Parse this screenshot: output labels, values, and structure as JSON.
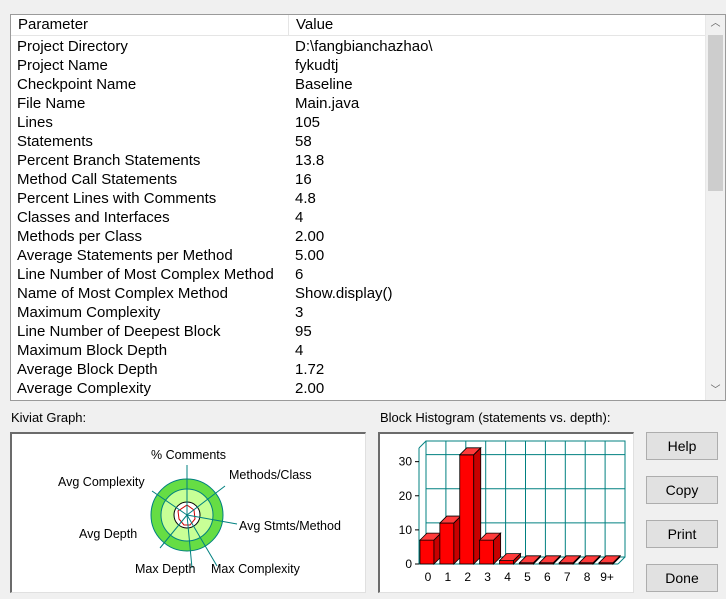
{
  "table": {
    "headers": {
      "parameter": "Parameter",
      "value": "Value"
    },
    "rows": [
      [
        "Project Directory",
        "D:\\fangbianchazhao\\"
      ],
      [
        "Project Name",
        "fykudtj"
      ],
      [
        "Checkpoint Name",
        "Baseline"
      ],
      [
        "File Name",
        "Main.java"
      ],
      [
        "Lines",
        "105"
      ],
      [
        "Statements",
        "58"
      ],
      [
        "Percent Branch Statements",
        "13.8"
      ],
      [
        "Method Call Statements",
        "16"
      ],
      [
        "Percent Lines with Comments",
        "4.8"
      ],
      [
        "Classes and Interfaces",
        "4"
      ],
      [
        "Methods per Class",
        "2.00"
      ],
      [
        "Average Statements per Method",
        "5.00"
      ],
      [
        "Line Number of Most Complex Method",
        "6"
      ],
      [
        "Name of Most Complex Method",
        "Show.display()"
      ],
      [
        "Maximum Complexity",
        "3"
      ],
      [
        "Line Number of Deepest Block",
        "95"
      ],
      [
        "Maximum Block Depth",
        "4"
      ],
      [
        "Average Block Depth",
        "1.72"
      ],
      [
        "Average Complexity",
        "2.00"
      ]
    ]
  },
  "scrollbar": {
    "up_glyph": "︿",
    "down_glyph": "﹀"
  },
  "kiviat": {
    "label": "Kiviat Graph:",
    "axes": [
      "% Comments",
      "Methods/Class",
      "Avg Stmts/Method",
      "Max Complexity",
      "Max Depth",
      "Avg Depth",
      "Avg Complexity"
    ]
  },
  "histogram": {
    "label": "Block Histogram (statements vs. depth):",
    "chart_data": {
      "type": "bar",
      "categories": [
        "0",
        "1",
        "2",
        "3",
        "4",
        "5",
        "6",
        "7",
        "8",
        "9+"
      ],
      "values": [
        7,
        12,
        32,
        7,
        1,
        0,
        0,
        0,
        0,
        0
      ],
      "ylim": [
        0,
        34
      ],
      "yticks": [
        0,
        10,
        20,
        30
      ],
      "grid": true,
      "bar_color": "#ff0000"
    }
  },
  "buttons": {
    "help": "Help",
    "copy": "Copy",
    "print": "Print",
    "done": "Done"
  },
  "colors": {
    "kiviat_ring": "#66dd44",
    "kiviat_band": "#c8ff96",
    "kiviat_spoke": "#008080",
    "hist_grid": "#008080",
    "bar": "#ff0000"
  }
}
